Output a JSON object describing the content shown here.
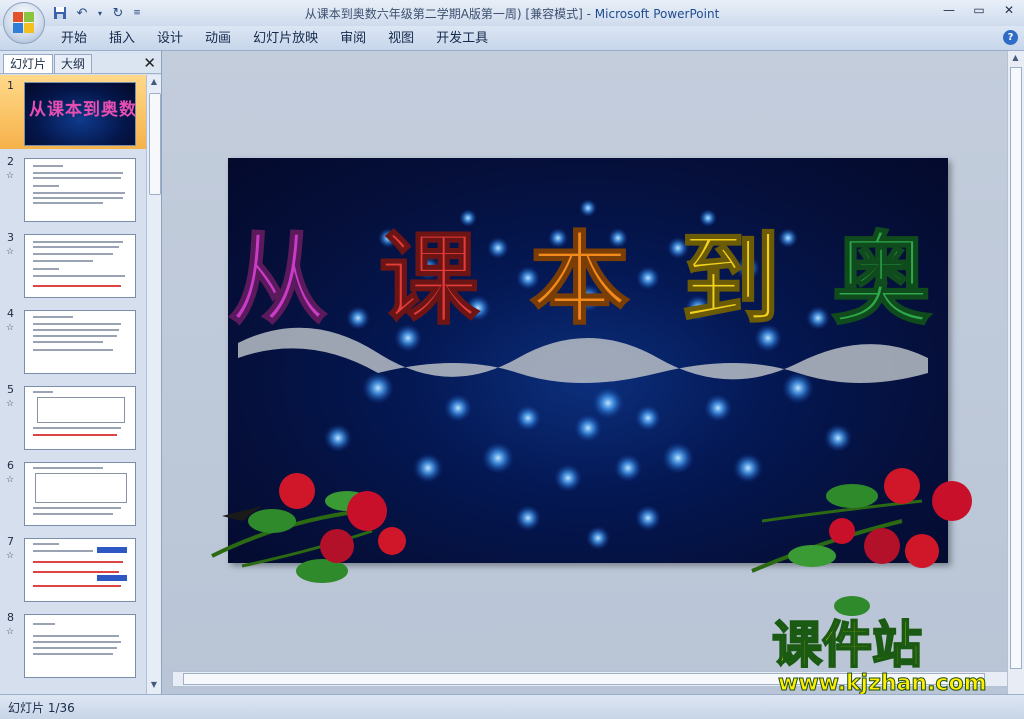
{
  "window": {
    "title": "从课本到奥数六年级第二学期A版第一周) [兼容模式]",
    "app_name": "Microsoft PowerPoint"
  },
  "ribbon": {
    "tabs": [
      "开始",
      "插入",
      "设计",
      "动画",
      "幻灯片放映",
      "审阅",
      "视图",
      "开发工具"
    ]
  },
  "left_pane": {
    "tabs": [
      "幻灯片",
      "大纲"
    ],
    "slides": [
      {
        "num": "1",
        "selected": true,
        "thumb_title": "从课本到奥数"
      },
      {
        "num": "2"
      },
      {
        "num": "3"
      },
      {
        "num": "4"
      },
      {
        "num": "5"
      },
      {
        "num": "6"
      },
      {
        "num": "7"
      },
      {
        "num": "8"
      }
    ]
  },
  "slide": {
    "title_chars": [
      "从",
      "课",
      "本",
      "到",
      "奥",
      "数"
    ],
    "title_colors": [
      "#c83cc8",
      "#e63b3b",
      "#f28a1e",
      "#f2d21e",
      "#2fa84a",
      "#6a3ed8"
    ]
  },
  "watermark": {
    "line1": "课件站",
    "line2": "www.kjzhan.com"
  },
  "status": {
    "slide_info": "幻灯片 1/36"
  },
  "icons": [
    "office-button-icon",
    "save-icon",
    "undo-icon",
    "redo-icon",
    "customize-qat-icon",
    "minimize-icon",
    "maximize-icon",
    "close-icon",
    "help-icon",
    "pane-close-icon",
    "animation-star-icon"
  ]
}
